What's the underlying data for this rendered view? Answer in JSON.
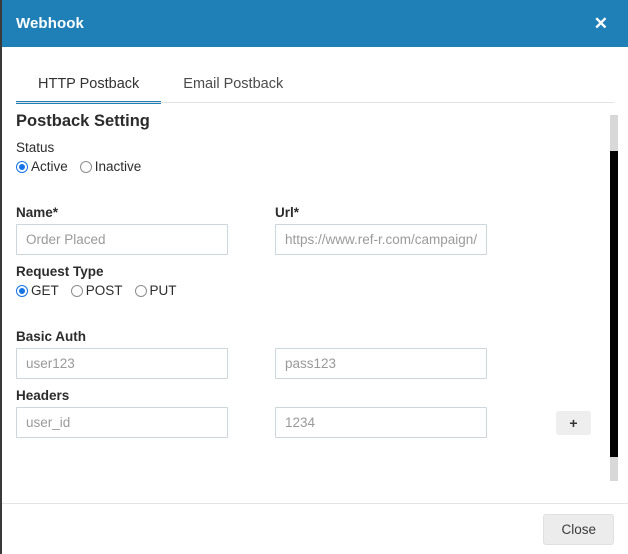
{
  "dialog": {
    "title": "Webhook",
    "close_icon": "close-x-icon",
    "header_color": "#1f80b8"
  },
  "tabs": [
    {
      "label": "HTTP Postback",
      "active": true
    },
    {
      "label": "Email Postback",
      "active": false
    }
  ],
  "form": {
    "section_title": "Postback Setting",
    "status": {
      "label": "Status",
      "options": [
        {
          "label": "Active",
          "selected": true
        },
        {
          "label": "Inactive",
          "selected": false
        }
      ]
    },
    "name": {
      "label": "Name*",
      "value": "",
      "placeholder": "Order Placed"
    },
    "url": {
      "label": "Url*",
      "value": "",
      "placeholder": "https://www.ref-r.com/campaign/r"
    },
    "request_type": {
      "label": "Request Type",
      "options": [
        {
          "label": "GET",
          "selected": true
        },
        {
          "label": "POST",
          "selected": false
        },
        {
          "label": "PUT",
          "selected": false
        }
      ]
    },
    "basic_auth": {
      "label": "Basic Auth",
      "username": {
        "value": "",
        "placeholder": "user123"
      },
      "password": {
        "value": "",
        "placeholder": "pass123"
      }
    },
    "headers": {
      "label": "Headers",
      "key": {
        "value": "",
        "placeholder": "user_id"
      },
      "value_field": {
        "value": "",
        "placeholder": "1234"
      },
      "add_label": "+"
    }
  },
  "footer": {
    "close_label": "Close"
  },
  "scrollbar": {
    "orientation": "vertical"
  }
}
